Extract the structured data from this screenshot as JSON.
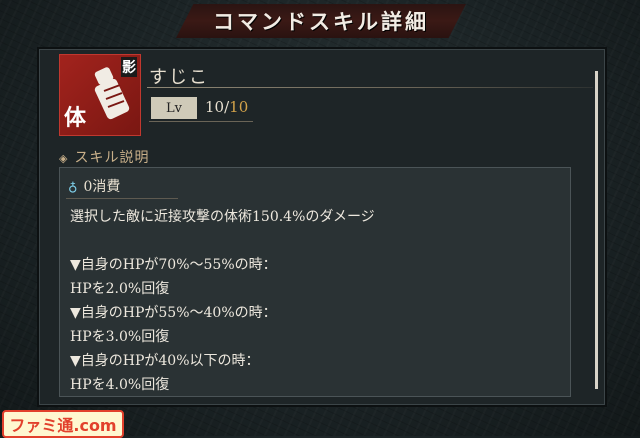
{
  "header": {
    "title": "コマンドスキル詳細"
  },
  "skill": {
    "icon_kanji_main": "体",
    "icon_kanji_corner": "影",
    "name": "すじこ",
    "level_label": "Lv",
    "level_current": "10",
    "level_separator": "/",
    "level_max": "10"
  },
  "section": {
    "title": "スキル説明"
  },
  "description": {
    "cost": "0消費",
    "lines": [
      "選択した敵に近接攻撃の体術150.4%のダメージ",
      "",
      "▼自身のHPが70%〜55%の時：",
      "HPを2.0%回復",
      "▼自身のHPが55%〜40%の時：",
      "HPを3.0%回復",
      "▼自身のHPが40%以下の時：",
      "HPを4.0%回復"
    ]
  },
  "watermark": {
    "text": "ファミ通.com"
  },
  "colors": {
    "accent_red": "#a2231d",
    "level_max": "#d2a24a",
    "cost_drop": "#7fd0ea"
  }
}
